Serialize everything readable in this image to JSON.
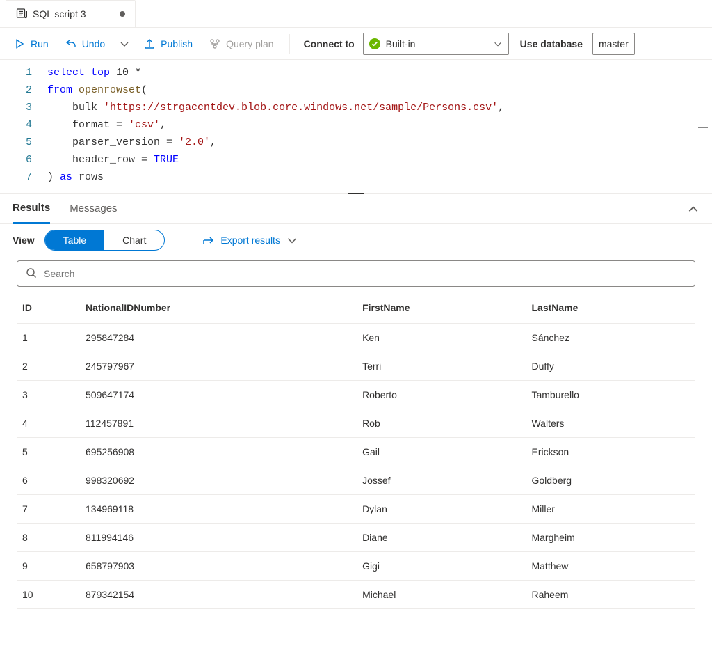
{
  "tab": {
    "title": "SQL script 3",
    "dirty": true
  },
  "toolbar": {
    "run": "Run",
    "undo": "Undo",
    "publish": "Publish",
    "queryplan": "Query plan",
    "connect_to": "Connect to",
    "connection": "Built-in",
    "use_database": "Use database",
    "database": "master"
  },
  "editor": {
    "lines": [
      {
        "n": 1,
        "segments": [
          {
            "t": "select",
            "c": "kw"
          },
          {
            "t": " "
          },
          {
            "t": "top",
            "c": "kw"
          },
          {
            "t": " 10 *",
            "c": ""
          }
        ]
      },
      {
        "n": 2,
        "segments": [
          {
            "t": "from",
            "c": "kw"
          },
          {
            "t": " "
          },
          {
            "t": "openrowset",
            "c": "fn"
          },
          {
            "t": "("
          }
        ]
      },
      {
        "n": 3,
        "segments": [
          {
            "t": "    bulk "
          },
          {
            "t": "'",
            "c": "str"
          },
          {
            "t": "https://strgaccntdev.blob.core.windows.net/sample/Persons.csv",
            "c": "url"
          },
          {
            "t": "'",
            "c": "str"
          },
          {
            "t": ","
          }
        ]
      },
      {
        "n": 4,
        "segments": [
          {
            "t": "    format = "
          },
          {
            "t": "'csv'",
            "c": "str"
          },
          {
            "t": ","
          }
        ]
      },
      {
        "n": 5,
        "segments": [
          {
            "t": "    parser_version = "
          },
          {
            "t": "'2.0'",
            "c": "str"
          },
          {
            "t": ","
          }
        ]
      },
      {
        "n": 6,
        "segments": [
          {
            "t": "    header_row = "
          },
          {
            "t": "TRUE",
            "c": "bool"
          }
        ]
      },
      {
        "n": 7,
        "segments": [
          {
            "t": ") "
          },
          {
            "t": "as",
            "c": "kw"
          },
          {
            "t": " rows"
          }
        ]
      }
    ]
  },
  "panel": {
    "tabs": {
      "results": "Results",
      "messages": "Messages"
    },
    "view_label": "View",
    "pills": {
      "table": "Table",
      "chart": "Chart"
    },
    "export": "Export results",
    "search_placeholder": "Search"
  },
  "table": {
    "columns": [
      "ID",
      "NationalIDNumber",
      "FirstName",
      "LastName"
    ],
    "rows": [
      [
        "1",
        "295847284",
        "Ken",
        "Sánchez"
      ],
      [
        "2",
        "245797967",
        "Terri",
        "Duffy"
      ],
      [
        "3",
        "509647174",
        "Roberto",
        "Tamburello"
      ],
      [
        "4",
        "112457891",
        "Rob",
        "Walters"
      ],
      [
        "5",
        "695256908",
        "Gail",
        "Erickson"
      ],
      [
        "6",
        "998320692",
        "Jossef",
        "Goldberg"
      ],
      [
        "7",
        "134969118",
        "Dylan",
        "Miller"
      ],
      [
        "8",
        "811994146",
        "Diane",
        "Margheim"
      ],
      [
        "9",
        "658797903",
        "Gigi",
        "Matthew"
      ],
      [
        "10",
        "879342154",
        "Michael",
        "Raheem"
      ]
    ]
  }
}
